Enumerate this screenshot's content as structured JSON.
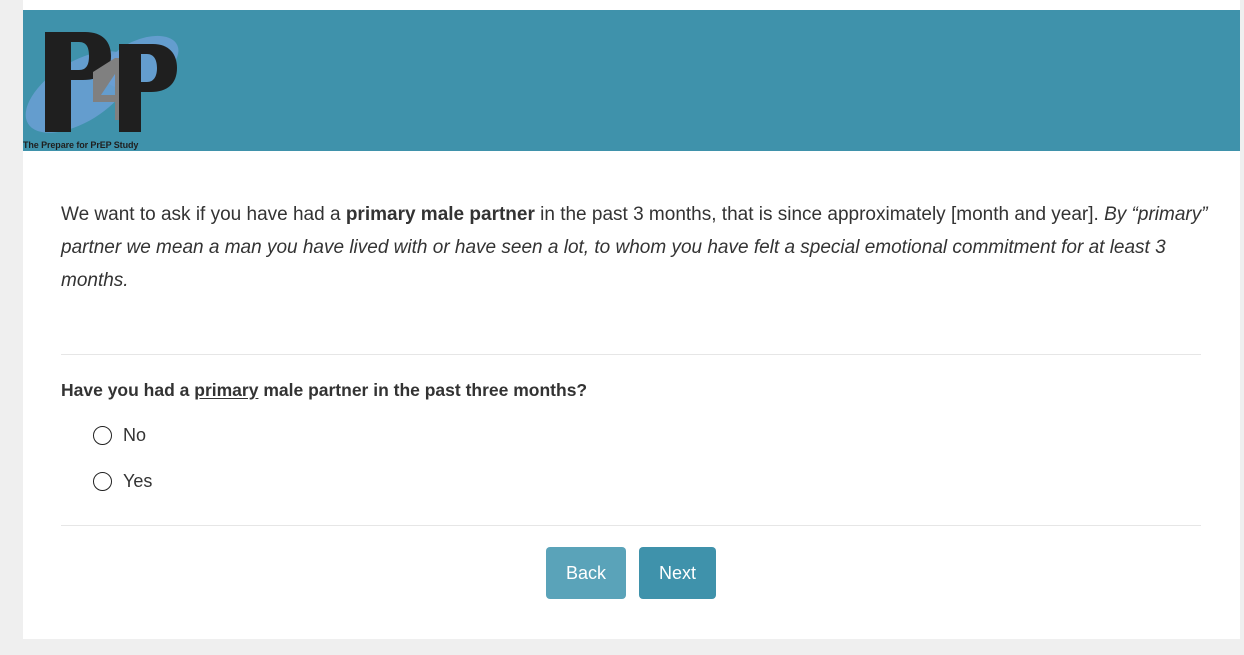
{
  "header": {
    "logo_caption": "The Prepare for PrEP Study",
    "logo_letters": "P4P"
  },
  "intro": {
    "part1": "We want to ask if you have had a ",
    "bold": "primary male partner",
    "part2": " in the past 3 months, that is since approximately [month and year]. ",
    "italic": "By “primary” partner we mean a man you have lived with or have seen a lot, to whom you have felt a special emotional commitment for at least 3 months."
  },
  "question": {
    "prefix": "Have you had a ",
    "underlined": "primary",
    "suffix": " male partner in the past three months?"
  },
  "options": [
    {
      "label": "No",
      "selected": false
    },
    {
      "label": "Yes",
      "selected": false
    }
  ],
  "buttons": {
    "back": "Back",
    "next": "Next"
  },
  "colors": {
    "header_bg": "#3f92ab",
    "back_bg": "#5aa3b9",
    "next_bg": "#3f92ab"
  }
}
